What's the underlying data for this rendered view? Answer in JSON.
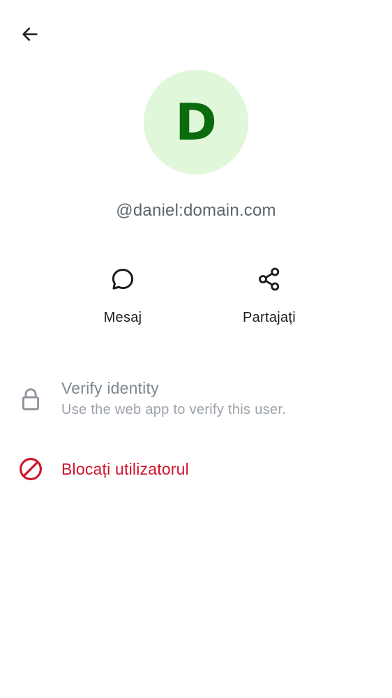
{
  "header": {
    "back_icon": "arrow-left-icon"
  },
  "profile": {
    "avatar_initial": "D",
    "avatar_bg": "#e0f7da",
    "avatar_fg": "#0a6b0d",
    "user_id": "@daniel:domain.com"
  },
  "actions": {
    "message": {
      "label": "Mesaj",
      "icon": "chat-bubble-icon"
    },
    "share": {
      "label": "Partajați",
      "icon": "share-icon"
    }
  },
  "verify": {
    "icon": "lock-icon",
    "title": "Verify identity",
    "subtitle": "Use the web app to verify this user."
  },
  "block": {
    "icon": "block-icon",
    "label": "Blocați utilizatorul",
    "color": "#d1132a"
  }
}
